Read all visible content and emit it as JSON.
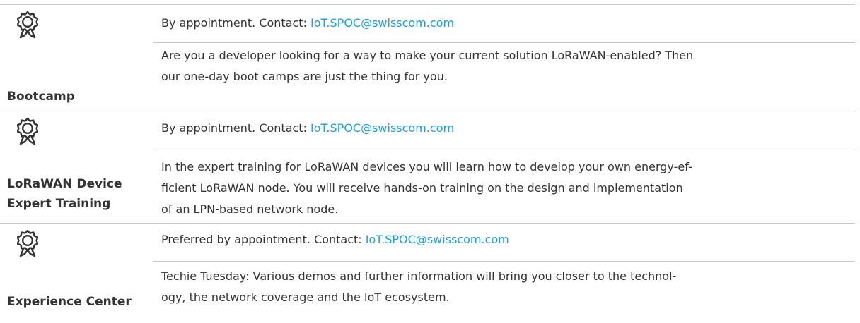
{
  "offerings": [
    {
      "icon": "award-badge-icon",
      "name": "Bootcamp",
      "availability_text": "By appointment. Contact: ",
      "contact_email": "IoT.SPOC@swisscom.com",
      "description_lines": [
        "Are you a developer looking for a way to make your current solution LoRaWAN-enabled? Then",
        "our one-day boot camps are just the thing for you."
      ]
    },
    {
      "icon": "award-badge-icon",
      "name": "LoRaWAN Device Expert Training",
      "availability_text": "By appointment. Contact: ",
      "contact_email": "IoT.SPOC@swisscom.com",
      "description_lines": [
        "In the expert training for LoRaWAN devices you will learn how to develop your own energy-ef-",
        "ficient LoRaWAN node. You will receive hands-on training on the design and implementation",
        "of an LPN-based network node."
      ]
    },
    {
      "icon": "award-badge-icon",
      "name": "Experience Center",
      "availability_text": "Preferred by appointment. Contact: ",
      "contact_email": "IoT.SPOC@swisscom.com",
      "description_lines": [
        "Techie Tuesday: Various demos and further information will bring you closer to the technol-",
        "ogy, the network coverage and the IoT ecosystem."
      ]
    }
  ],
  "colors": {
    "text": "#333333",
    "link": "#1aa0e6",
    "rule": "#c8c8c8"
  }
}
